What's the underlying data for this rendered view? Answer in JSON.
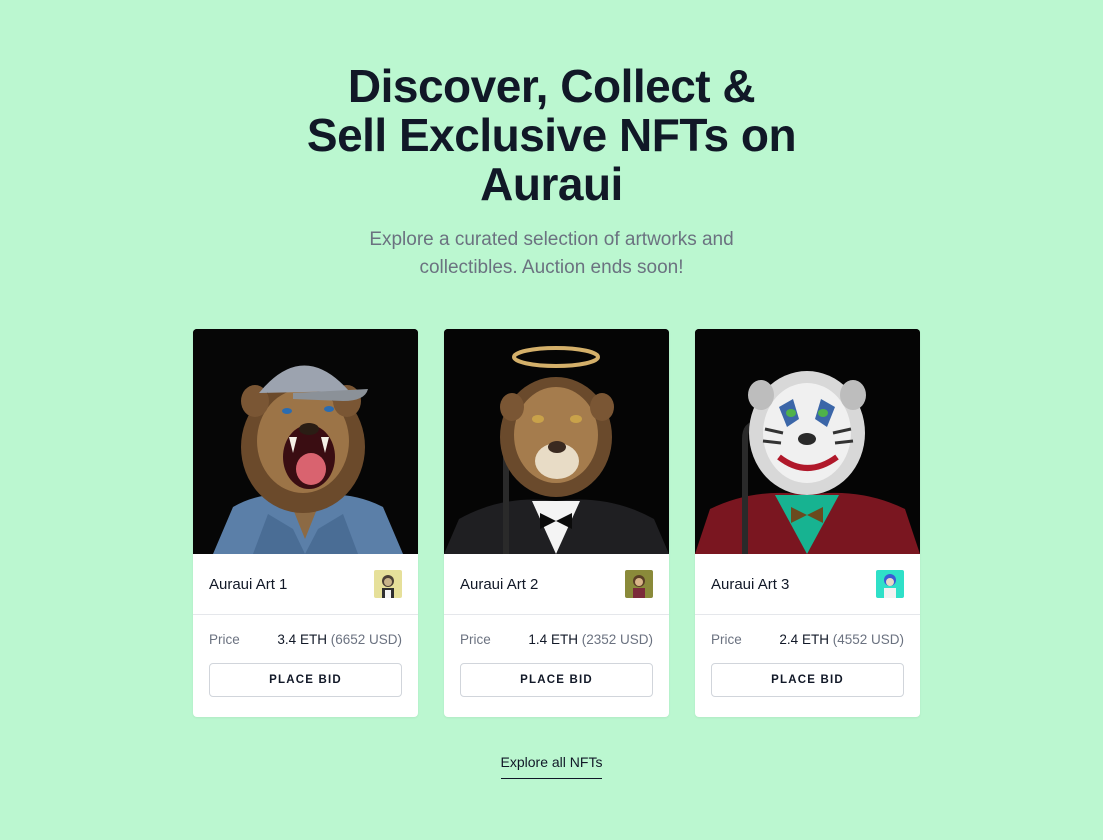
{
  "hero": {
    "title_line1": "Discover, Collect &",
    "title_line2": "Sell Exclusive NFTs on",
    "title_line3": "Auraui",
    "subtitle_line1": "Explore a curated selection of artworks and",
    "subtitle_line2": "collectibles. Auction ends soon!"
  },
  "cards": [
    {
      "title": "Auraui Art 1",
      "price_label": "Price",
      "eth": "3.4 ETH",
      "usd": "(6652 USD)",
      "button": "PLACE BID",
      "image_icon": "lion-cap-denim-art",
      "avatar_icon": "ape-avatar-yellow"
    },
    {
      "title": "Auraui Art 2",
      "price_label": "Price",
      "eth": "1.4 ETH",
      "usd": "(2352 USD)",
      "button": "PLACE BID",
      "image_icon": "lion-halo-tuxedo-art",
      "avatar_icon": "ape-avatar-olive"
    },
    {
      "title": "Auraui Art 3",
      "price_label": "Price",
      "eth": "2.4 ETH",
      "usd": "(4552 USD)",
      "button": "PLACE BID",
      "image_icon": "white-tiger-joker-art",
      "avatar_icon": "ape-avatar-teal"
    }
  ],
  "footer": {
    "explore_label": "Explore all NFTs"
  },
  "colors": {
    "background": "#bbf7d0",
    "text_dark": "#111827",
    "text_muted": "#6b7280",
    "card_bg": "#ffffff"
  }
}
